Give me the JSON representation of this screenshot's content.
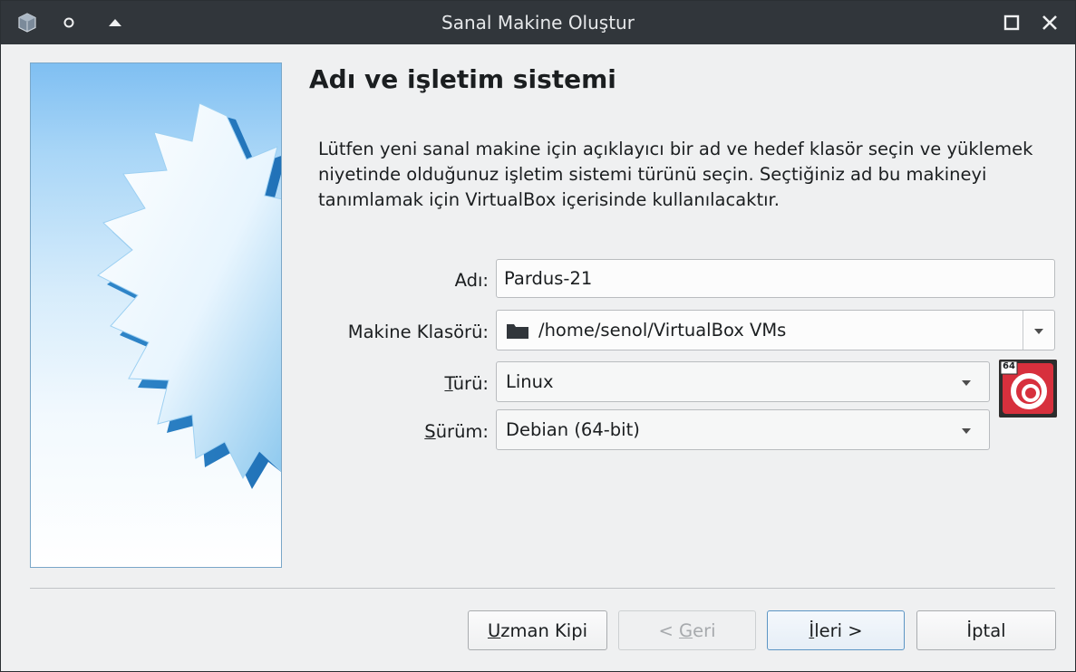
{
  "window": {
    "title": "Sanal Makine Oluştur"
  },
  "page": {
    "heading": "Adı ve işletim sistemi",
    "description": "Lütfen yeni sanal makine için açıklayıcı bir ad ve hedef klasör seçin ve yüklemek niyetinde olduğunuz işletim sistemi türünü seçin. Seçtiğiniz ad bu makineyi tanımlamak için VirtualBox içerisinde kullanılacaktır."
  },
  "form": {
    "name_label": "Adı:",
    "name_value": "Pardus-21",
    "folder_label": "Makine Klasörü:",
    "folder_value": "/home/senol/VirtualBox VMs",
    "type_label_u": "T",
    "type_label_rest": "ürü:",
    "type_value": "Linux",
    "version_label_u": "S",
    "version_label_rest": "ürüm:",
    "version_value": "Debian (64-bit)",
    "os_badge": "64"
  },
  "buttons": {
    "expert_u": "U",
    "expert_rest": "zman Kipi",
    "back_prefix": "< ",
    "back_u": "G",
    "back_rest": "eri",
    "next_u": "İ",
    "next_rest": "leri >",
    "cancel": "İptal"
  },
  "colors": {
    "titlebar": "#31363b",
    "window_bg": "#eff0f1",
    "default_button_border": "#5c95c4",
    "os_icon_red": "#d7303d"
  },
  "icons": {
    "app": "virtualbox-icon",
    "keep_above": "circle-icon",
    "shade": "chevron-up-icon",
    "maximize": "maximize-icon",
    "close": "close-icon",
    "folder": "folder-icon",
    "os": "debian-os-icon"
  }
}
